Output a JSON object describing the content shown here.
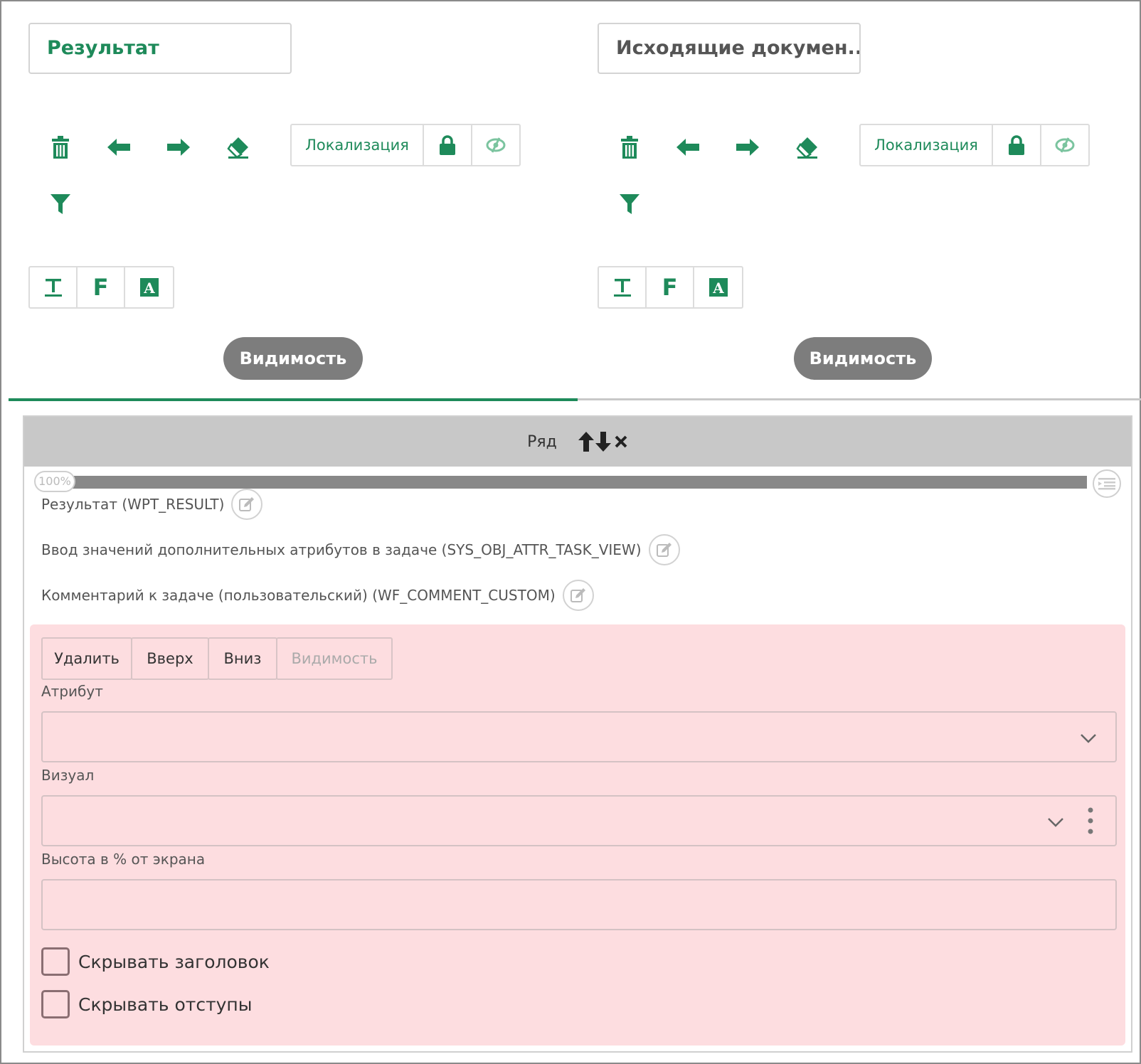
{
  "tabs": [
    {
      "title": "Результат",
      "localization_label": "Локализация",
      "visibility_label": "Видимость"
    },
    {
      "title": "Исходящие докумен...",
      "localization_label": "Локализация",
      "visibility_label": "Видимость"
    }
  ],
  "format_buttons": [
    "T",
    "F",
    "A"
  ],
  "row": {
    "header_label": "Ряд",
    "progress_label": "100%",
    "progress_value": 100,
    "attributes": [
      "Результат (WPT_RESULT)",
      "Ввод значений дополнительных атрибутов в задаче (SYS_OBJ_ATTR_TASK_VIEW)",
      "Комментарий к задаче (пользовательский) (WF_COMMENT_CUSTOM)"
    ]
  },
  "editor": {
    "actions": [
      "Удалить",
      "Вверх",
      "Вниз",
      "Видимость"
    ],
    "fields": {
      "attribute_label": "Атрибут",
      "attribute_value": "",
      "visual_label": "Визуал",
      "visual_value": "",
      "height_label": "Высота в % от экрана",
      "height_value": ""
    },
    "checkboxes": [
      {
        "label": "Скрывать заголовок",
        "checked": false
      },
      {
        "label": "Скрывать отступы",
        "checked": false
      }
    ]
  },
  "colors": {
    "accent": "#1e8a5a",
    "pill": "#7d7d7d",
    "header_gray": "#c8c8c8",
    "pink_panel": "#fddde0"
  },
  "icons": [
    "trash-icon",
    "arrow-left-icon",
    "arrow-right-icon",
    "eraser-icon",
    "lock-icon",
    "eye-slash-icon",
    "filter-icon",
    "text-underline-icon",
    "font-icon",
    "font-box-icon",
    "arrow-up-icon",
    "arrow-down-icon",
    "close-icon",
    "edit-icon",
    "chevron-down-icon",
    "kebab-icon",
    "list-icon"
  ]
}
